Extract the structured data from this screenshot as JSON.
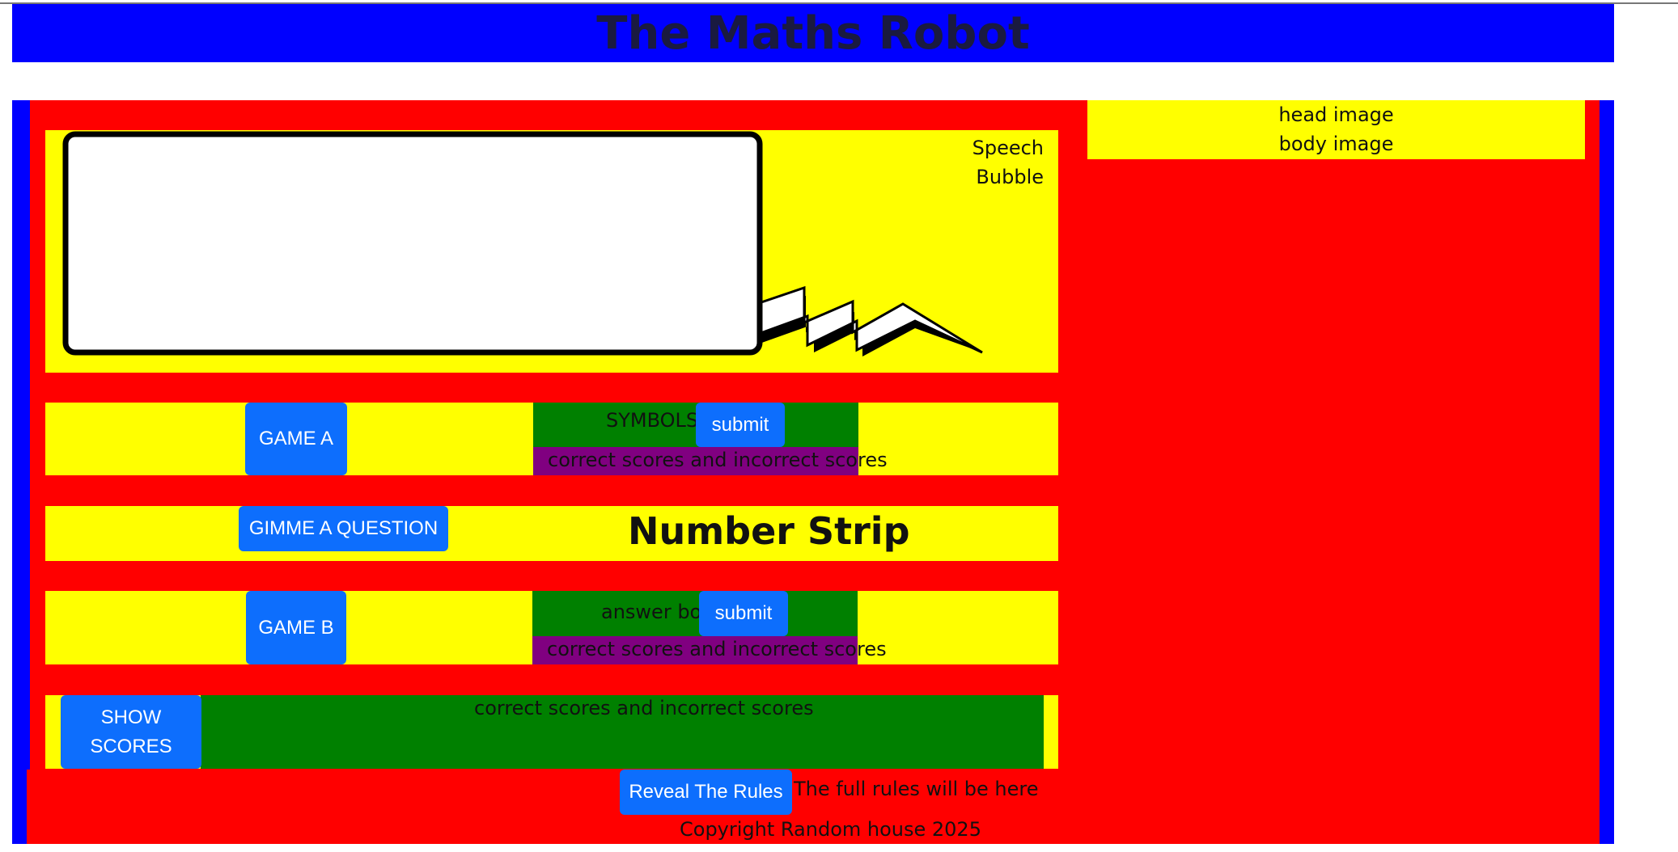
{
  "header": {
    "title": "The Maths Robot"
  },
  "speech": {
    "label_line1": "Speech",
    "label_line2": "Bubble"
  },
  "robot": {
    "head_label": "head image",
    "body_label": "body image"
  },
  "game_a": {
    "button_label": "GAME A",
    "symbols_label": "SYMBOLS",
    "submit_label": "submit",
    "scores_label": "correct scores and incorrect scores"
  },
  "question": {
    "button_label": "GIMME A QUESTION",
    "number_strip": "Number Strip"
  },
  "game_b": {
    "button_label": "GAME B",
    "answer_label": "answer box",
    "submit_label": "submit",
    "scores_label": "correct scores and incorrect scores"
  },
  "scores": {
    "button_line1": "SHOW",
    "button_line2": "SCORES",
    "summary_label": "correct scores and incorrect scores"
  },
  "rules": {
    "button_label": "Reveal The Rules",
    "placeholder": "The full rules will be here"
  },
  "footer": {
    "copyright": "Copyright Random house 2025"
  },
  "colors": {
    "header_bg": "#0000ff",
    "panel_red": "#ff0000",
    "panel_yellow": "#ffff00",
    "button_blue": "#0d6efd",
    "box_green": "#008000",
    "box_purple": "#800080"
  }
}
